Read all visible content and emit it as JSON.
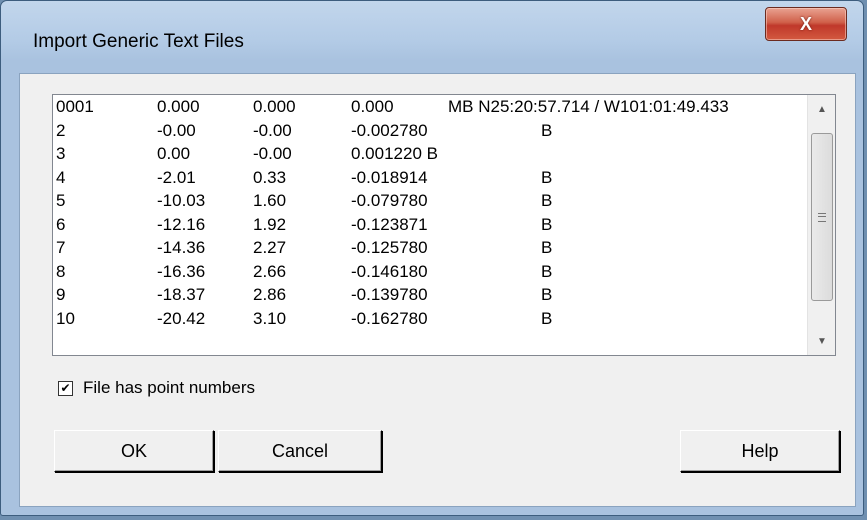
{
  "window": {
    "title": "Import Generic Text Files",
    "close_label": "X"
  },
  "preview": {
    "rows": [
      [
        "0001",
        "0.000",
        "0.000",
        "0.000",
        "MB N25:20:57.714 / W101:01:49.433",
        ""
      ],
      [
        "2",
        "-0.00",
        "-0.00",
        "-0.002780",
        "",
        "B"
      ],
      [
        "3",
        "0.00",
        "-0.00",
        "0.001220 B",
        "",
        ""
      ],
      [
        "4",
        "-2.01",
        "0.33",
        "-0.018914",
        "",
        "B"
      ],
      [
        "5",
        "-10.03",
        "1.60",
        "-0.079780",
        "",
        "B"
      ],
      [
        "6",
        "-12.16",
        "1.92",
        "-0.123871",
        "",
        "B"
      ],
      [
        "7",
        "-14.36",
        "2.27",
        "-0.125780",
        "",
        "B"
      ],
      [
        "8",
        "-16.36",
        "2.66",
        "-0.146180",
        "",
        "B"
      ],
      [
        "9",
        "-18.37",
        "2.86",
        "-0.139780",
        "",
        "B"
      ],
      [
        "10",
        "-20.42",
        "3.10",
        "-0.162780",
        "",
        "B"
      ]
    ]
  },
  "options": {
    "point_numbers_label": "File has point numbers",
    "point_numbers_checked": true,
    "check_mark": "✔"
  },
  "buttons": {
    "ok": "OK",
    "cancel": "Cancel",
    "help": "Help"
  },
  "scrollbar": {
    "up_arrow": "▲",
    "down_arrow": "▼"
  }
}
